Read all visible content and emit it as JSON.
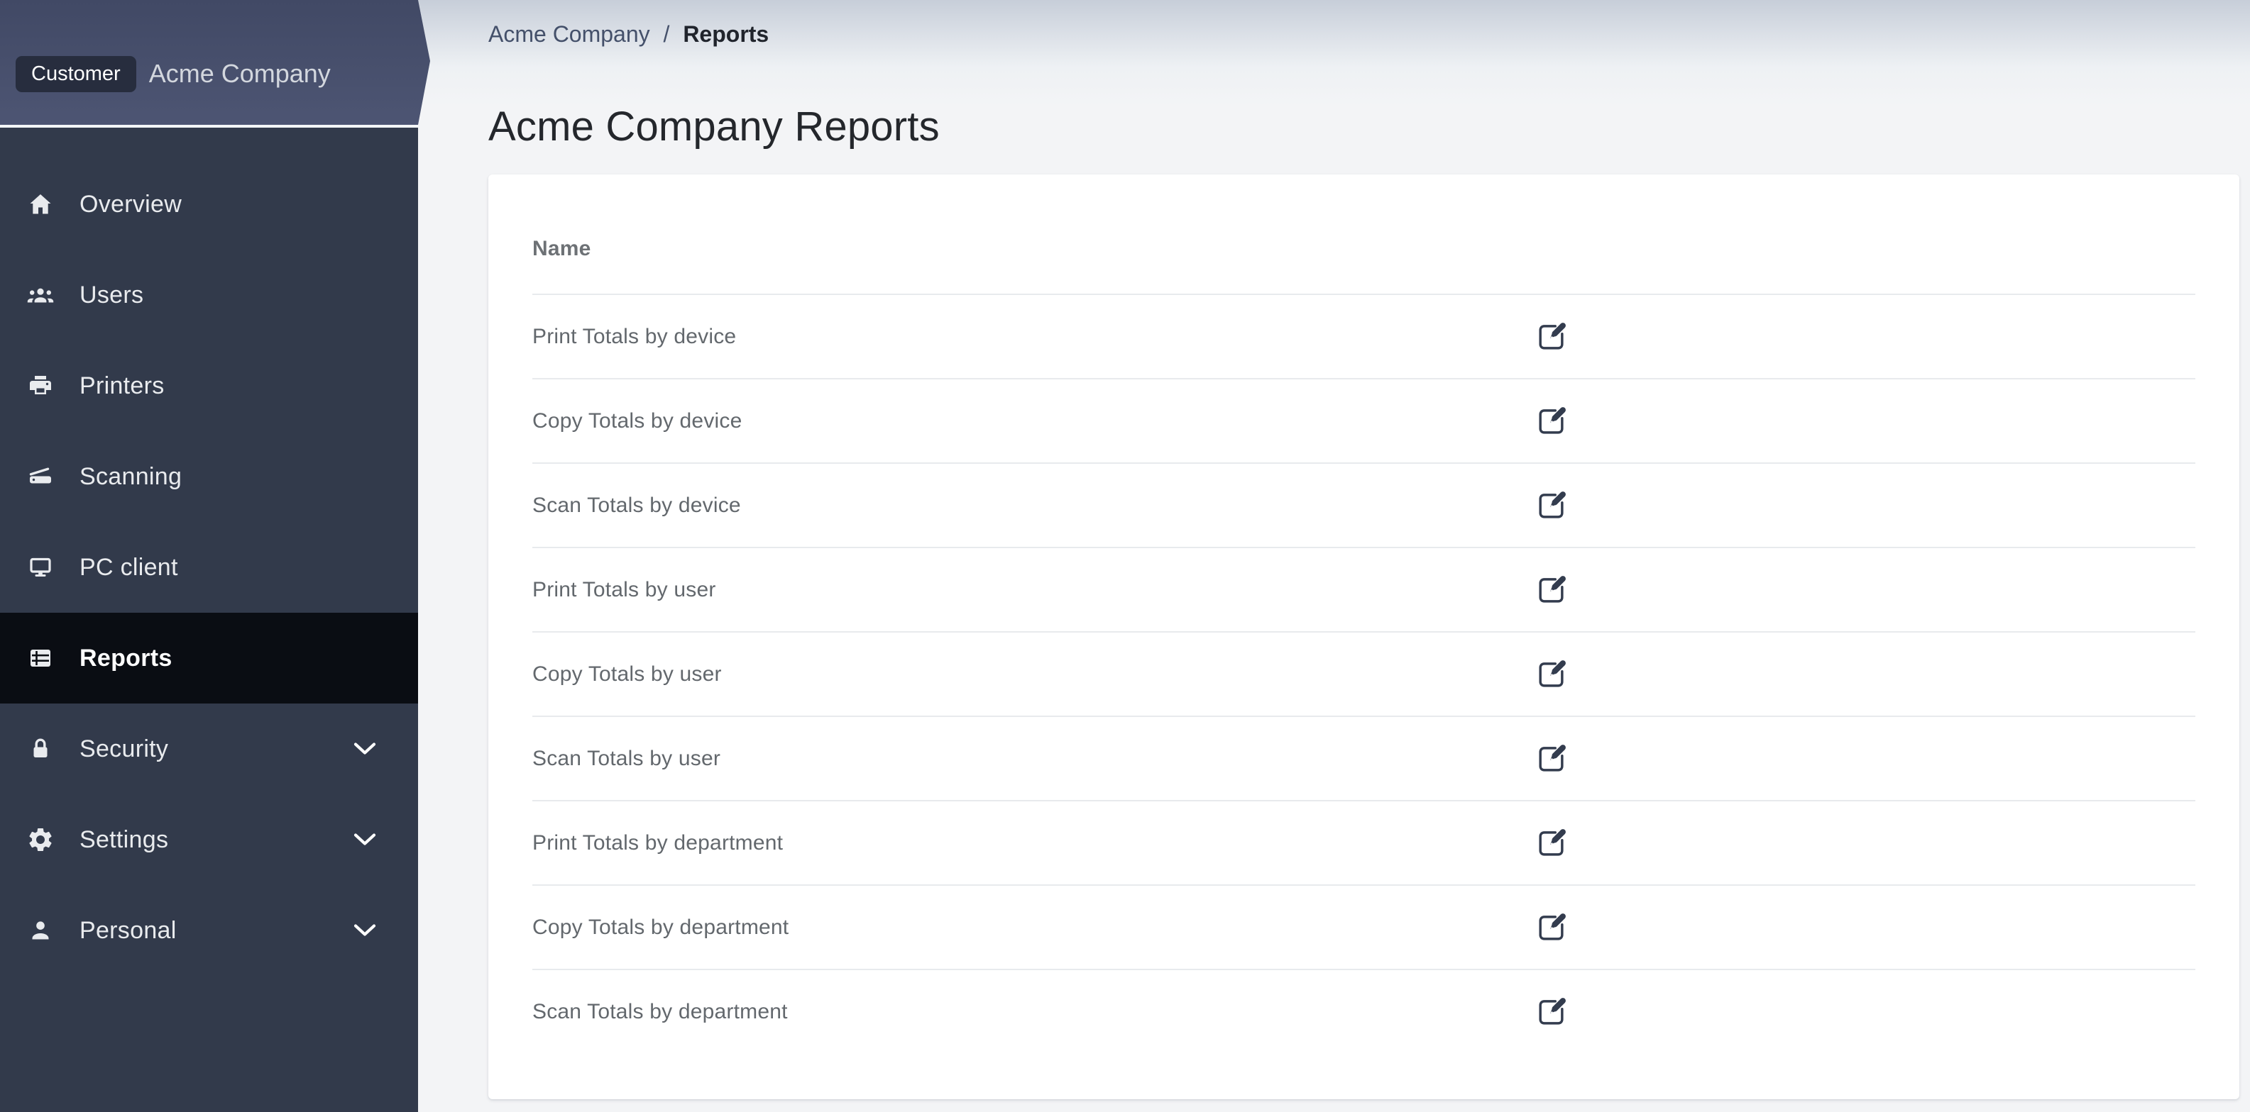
{
  "sidebar": {
    "header": {
      "badge_label": "Customer",
      "company_name": "Acme Company"
    },
    "items": [
      {
        "label": "Overview",
        "icon": "home-icon",
        "active": false,
        "expandable": false
      },
      {
        "label": "Users",
        "icon": "users-icon",
        "active": false,
        "expandable": false
      },
      {
        "label": "Printers",
        "icon": "printer-icon",
        "active": false,
        "expandable": false
      },
      {
        "label": "Scanning",
        "icon": "scanner-icon",
        "active": false,
        "expandable": false
      },
      {
        "label": "PC client",
        "icon": "monitor-icon",
        "active": false,
        "expandable": false
      },
      {
        "label": "Reports",
        "icon": "table-icon",
        "active": true,
        "expandable": false
      },
      {
        "label": "Security",
        "icon": "lock-icon",
        "active": false,
        "expandable": true
      },
      {
        "label": "Settings",
        "icon": "gear-icon",
        "active": false,
        "expandable": true
      },
      {
        "label": "Personal",
        "icon": "person-icon",
        "active": false,
        "expandable": true
      }
    ]
  },
  "breadcrumb": {
    "segments": [
      {
        "label": "Acme Company",
        "current": false
      },
      {
        "label": "Reports",
        "current": true
      }
    ],
    "separator": "/"
  },
  "page": {
    "title": "Acme Company Reports"
  },
  "table": {
    "columns": [
      {
        "label": "Name"
      }
    ],
    "rows": [
      {
        "name": "Print Totals by device",
        "action_icon": "edit-icon"
      },
      {
        "name": "Copy Totals by device",
        "action_icon": "edit-icon"
      },
      {
        "name": "Scan Totals by device",
        "action_icon": "edit-icon"
      },
      {
        "name": "Print Totals by user",
        "action_icon": "edit-icon"
      },
      {
        "name": "Copy Totals by user",
        "action_icon": "edit-icon"
      },
      {
        "name": "Scan Totals by user",
        "action_icon": "edit-icon"
      },
      {
        "name": "Print Totals by department",
        "action_icon": "edit-icon"
      },
      {
        "name": "Copy Totals by department",
        "action_icon": "edit-icon"
      },
      {
        "name": "Scan Totals by department",
        "action_icon": "edit-icon"
      }
    ]
  },
  "colors": {
    "sidebar_bg": "#323a4b",
    "sidebar_active_bg": "#0a0d13",
    "sidebar_text": "#e9ebee",
    "band_gradient_top": "#414965",
    "band_gradient_bottom": "#4d5573",
    "badge_bg": "#272d3e",
    "page_bg": "#f3f4f6",
    "page_bg_top": "#c7ced9",
    "card_bg": "#ffffff",
    "divider": "#e8eaed",
    "text_primary": "#24272c",
    "text_secondary": "#63686d",
    "breadcrumb_link": "#44506a",
    "action_icon": "#333c4e"
  }
}
